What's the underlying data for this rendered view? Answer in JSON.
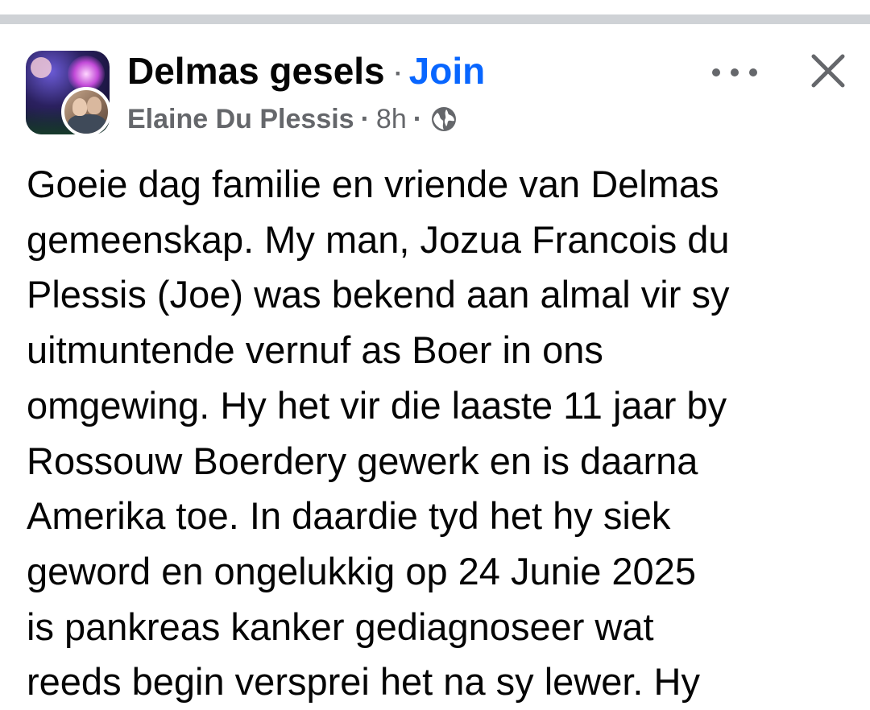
{
  "header": {
    "group_name": "Delmas gesels",
    "separator": "·",
    "join_label": "Join",
    "author": "Elaine Du Plessis",
    "meta_separator": "·",
    "time": "8h",
    "privacy_icon": "globe-icon",
    "more_icon": "more-horizontal-icon",
    "close_icon": "close-icon"
  },
  "post": {
    "text": "Goeie dag familie en vriende van Delmas\ngemeenskap. My man, Jozua Francois du\nPlessis (Joe) was bekend aan almal vir sy\nuitmuntende vernuf as Boer in ons\nomgewing. Hy het vir die laaste 11 jaar by\nRossouw Boerdery gewerk en is daarna\nAmerika toe. In daardie tyd het hy siek\ngeword en ongelukkig op 24 Junie 2025\nis pankreas kanker gediagnoseer wat\nreeds begin versprei het na sy lewer. Hy"
  },
  "colors": {
    "join": "#0866ff",
    "secondary_text": "#65676b",
    "primary_text": "#050505",
    "divider": "#cfd2d6"
  }
}
